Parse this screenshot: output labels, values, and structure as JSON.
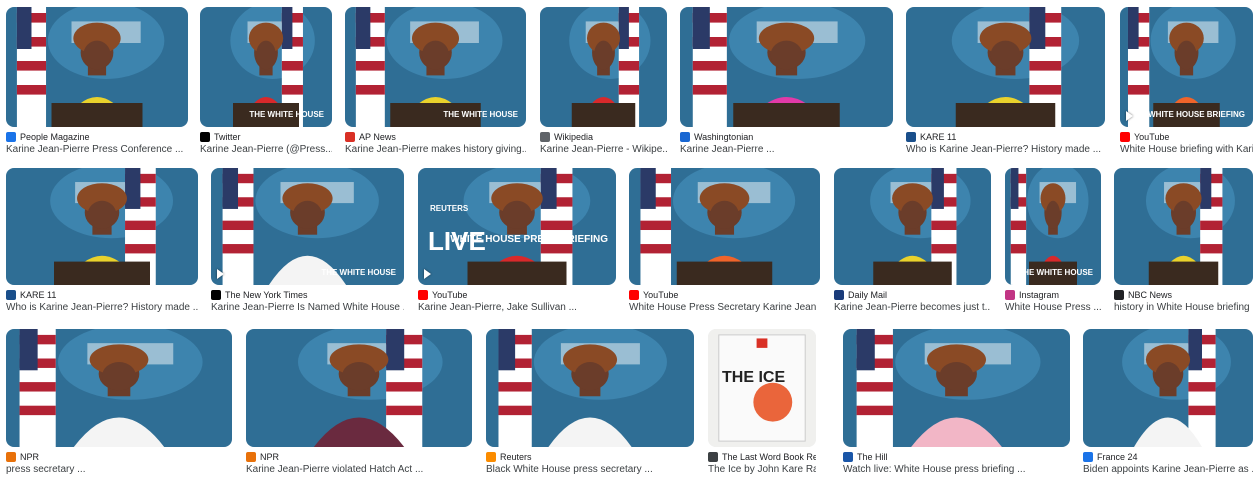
{
  "colors": {
    "backdrop_blue": "#2f6e95",
    "seal_blue": "#3f86b0",
    "yellow": "#e9d22c",
    "red": "#d9292b",
    "magenta": "#e23aa8",
    "orange": "#f0642a",
    "skin": "#6b3d2a",
    "hair": "#8a4a25",
    "flag_red": "#b22234",
    "flag_blue": "#2b3a67",
    "wood": "#3a2a1f",
    "play_icon": "#ffffff"
  },
  "results": [
    {
      "source": "People Magazine",
      "favicon": "people-favicon",
      "fav_color": "#1a73e8",
      "caption": "Karine Jean-Pierre Press Conference ...",
      "outfit": "yellow",
      "video": false
    },
    {
      "source": "Twitter",
      "favicon": "twitter-x-favicon",
      "fav_color": "#000000",
      "caption": "Karine Jean-Pierre (@Press...",
      "outfit": "red",
      "video": false,
      "overlay": "THE WHITE HOUSE"
    },
    {
      "source": "AP News",
      "favicon": "ap-news-favicon",
      "fav_color": "#d93025",
      "caption": "Karine Jean-Pierre makes history giving...",
      "outfit": "yellow",
      "video": false,
      "overlay": "THE WHITE HOUSE"
    },
    {
      "source": "Wikipedia",
      "favicon": "wikipedia-favicon",
      "fav_color": "#5f6368",
      "caption": "Karine Jean-Pierre - Wikipe...",
      "outfit": "red",
      "video": false
    },
    {
      "source": "Washingtonian",
      "favicon": "washingtonian-favicon",
      "fav_color": "#1967d2",
      "caption": "Karine Jean-Pierre ...",
      "outfit": "magenta",
      "video": false
    },
    {
      "source": "KARE 11",
      "favicon": "kare11-favicon",
      "fav_color": "#1a4f8b",
      "caption": "Who is Karine Jean-Pierre? History made ...",
      "outfit": "yellow",
      "video": false
    },
    {
      "source": "YouTube",
      "favicon": "youtube-favicon",
      "fav_color": "#ff0000",
      "caption": "White House briefing with Karine",
      "outfit": "orange",
      "video": true,
      "overlay": "WHITE HOUSE BRIEFING"
    },
    {
      "source": "KARE 11",
      "favicon": "kare11-favicon",
      "fav_color": "#1a4f8b",
      "caption": "Who is Karine Jean-Pierre? History made ...",
      "outfit": "yellow",
      "video": false
    },
    {
      "source": "The New York Times",
      "favicon": "nyt-favicon",
      "fav_color": "#000000",
      "caption": "Karine Jean-Pierre Is Named White House ...",
      "outfit": "white",
      "video": true,
      "overlay": "THE WHITE HOUSE"
    },
    {
      "source": "YouTube",
      "favicon": "youtube-favicon",
      "fav_color": "#ff0000",
      "caption": "Karine Jean-Pierre, Jake Sullivan ...",
      "outfit": "red",
      "video": true,
      "overlay": "WHITE HOUSE PRESS BRIEFING",
      "live": "LIVE",
      "reuters": "REUTERS"
    },
    {
      "source": "YouTube",
      "favicon": "youtube-favicon",
      "fav_color": "#ff0000",
      "caption": "White House Press Secretary Karine Jean ...",
      "outfit": "orange",
      "video": false
    },
    {
      "source": "Daily Mail",
      "favicon": "daily-mail-favicon",
      "fav_color": "#1a3b7a",
      "caption": "Karine Jean-Pierre becomes just t...",
      "outfit": "yellow",
      "video": false
    },
    {
      "source": "Instagram",
      "favicon": "instagram-favicon",
      "fav_color": "#c13584",
      "caption": "White House Press ...",
      "outfit": "red",
      "video": false,
      "overlay": "THE WHITE HOUSE"
    },
    {
      "source": "NBC News",
      "favicon": "nbc-favicon",
      "fav_color": "#202124",
      "caption": "history in White House briefing r",
      "outfit": "yellow",
      "video": false
    },
    {
      "source": "NPR",
      "favicon": "npr-favicon",
      "fav_color": "#e8710a",
      "caption": "press secretary ...",
      "outfit": "white",
      "video": false
    },
    {
      "source": "NPR",
      "favicon": "npr-favicon",
      "fav_color": "#e8710a",
      "caption": "Karine Jean-Pierre violated Hatch Act ...",
      "outfit": "plum",
      "video": false
    },
    {
      "source": "Reuters",
      "favicon": "reuters-favicon",
      "fav_color": "#fb8c00",
      "caption": "Black White House press secretary ...",
      "outfit": "white",
      "video": false
    },
    {
      "source": "The Last Word Book Review",
      "favicon": "book-review-favicon",
      "fav_color": "#3c4043",
      "caption": "The Ice by John Kare Raa...",
      "outfit": "book",
      "video": false,
      "book_title": "THE ICE"
    },
    {
      "source": "The Hill",
      "favicon": "the-hill-favicon",
      "fav_color": "#1a56a8",
      "caption": "Watch live: White House press briefing ...",
      "outfit": "pink",
      "video": false
    },
    {
      "source": "France 24",
      "favicon": "france24-favicon",
      "fav_color": "#1a73e8",
      "caption": "Biden appoints Karine Jean-Pierre as ...",
      "outfit": "white",
      "video": false
    }
  ]
}
